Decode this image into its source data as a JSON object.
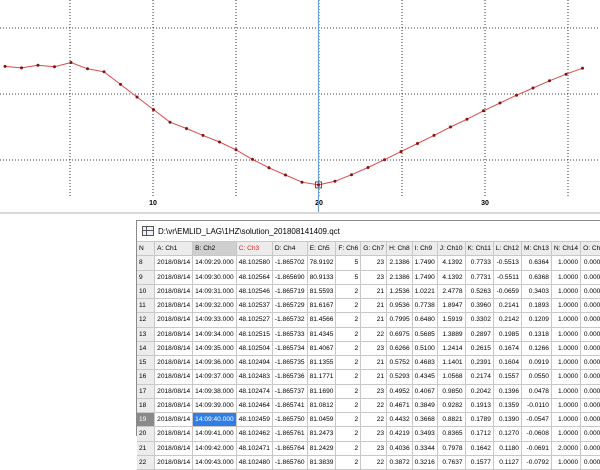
{
  "chart_data": {
    "type": "line",
    "series": [
      {
        "x": [
          0,
          1,
          2,
          3,
          4,
          5,
          6,
          7,
          8,
          9,
          10,
          11,
          12,
          13,
          14,
          15,
          16,
          17,
          18,
          19,
          20,
          21,
          22,
          23,
          24,
          25,
          26,
          27,
          28,
          29,
          30,
          31,
          32,
          33,
          34,
          35
        ],
        "y": [
          4.6,
          4.35,
          4.8,
          4.55,
          5.25,
          4.2,
          3.7,
          1.6,
          -0.5,
          -2.6,
          -4.7,
          -5.75,
          -6.9,
          -8.0,
          -9.3,
          -10.9,
          -12.3,
          -13.5,
          -14.7,
          -15.15,
          -14.55,
          -13.45,
          -12.25,
          -10.95,
          -9.6,
          -8.25,
          -6.9,
          -5.5,
          -4.2,
          -2.8,
          -1.5,
          -0.2,
          1.0,
          2.2,
          3.3,
          4.3
        ]
      }
    ],
    "x_tick_labels": [
      "10",
      "20",
      "30"
    ],
    "cursor_x": 19,
    "marker_index": 19,
    "colors": {
      "line": "#d94a4a",
      "marker": "#8b1010",
      "cursor": "#6fa2d4",
      "grid": "#000000"
    }
  },
  "window": {
    "title": "D:\\vr\\EMLID_LAG\\1HZ\\solution_201808141409.qct"
  },
  "table": {
    "headers": [
      "N",
      "A: Ch1",
      "B: Ch2",
      "C: Ch3",
      "D: Ch4",
      "E: Ch5",
      "F: Ch6",
      "G: Ch7",
      "H: Ch8",
      "I: Ch9",
      "J: Ch10",
      "K: Ch11",
      "L: Ch12",
      "M: Ch13",
      "N: Ch14",
      "O: Ch1"
    ],
    "rows": [
      [
        "8",
        "2018/08/14",
        "14:09:29.000",
        "48.102580",
        "-1.865702",
        "78.9192",
        "5",
        "23",
        "2.1386",
        "1.7490",
        "4.1392",
        "0.7733",
        "-0.5513",
        "0.6364",
        "1.0000",
        "0.0000"
      ],
      [
        "9",
        "2018/08/14",
        "14:09:30.000",
        "48.102564",
        "-1.865690",
        "80.9133",
        "5",
        "23",
        "2.1386",
        "1.7490",
        "4.1392",
        "0.7731",
        "-0.5511",
        "0.6368",
        "1.0000",
        "0.0000"
      ],
      [
        "10",
        "2018/08/14",
        "14:09:31.000",
        "48.102546",
        "-1.865719",
        "81.5593",
        "2",
        "21",
        "1.2536",
        "1.0221",
        "2.4778",
        "0.5263",
        "-0.0659",
        "0.3403",
        "1.0000",
        "0.0000"
      ],
      [
        "11",
        "2018/08/14",
        "14:09:32.000",
        "48.102537",
        "-1.865729",
        "81.6167",
        "2",
        "21",
        "0.9536",
        "0.7738",
        "1.8947",
        "0.3960",
        "0.2141",
        "0.1893",
        "1.0000",
        "0.0000"
      ],
      [
        "12",
        "2018/08/14",
        "14:09:33.000",
        "48.102527",
        "-1.865732",
        "81.4566",
        "2",
        "21",
        "0.7995",
        "0.6480",
        "1.5919",
        "0.3302",
        "0.2142",
        "0.1209",
        "1.0000",
        "0.0000"
      ],
      [
        "13",
        "2018/08/14",
        "14:09:34.000",
        "48.102515",
        "-1.865733",
        "81.4345",
        "2",
        "22",
        "0.6975",
        "0.5685",
        "1.3889",
        "0.2897",
        "0.1985",
        "0.1318",
        "1.0000",
        "0.0000"
      ],
      [
        "14",
        "2018/08/14",
        "14:09:35.000",
        "48.102504",
        "-1.865734",
        "81.4067",
        "2",
        "23",
        "0.6266",
        "0.5100",
        "1.2414",
        "0.2615",
        "0.1674",
        "0.1266",
        "1.0000",
        "0.0000"
      ],
      [
        "15",
        "2018/08/14",
        "14:09:36.000",
        "48.102494",
        "-1.865735",
        "81.1355",
        "2",
        "21",
        "0.5752",
        "0.4683",
        "1.1401",
        "0.2391",
        "0.1604",
        "0.0919",
        "1.0000",
        "0.0000"
      ],
      [
        "16",
        "2018/08/14",
        "14:09:37.000",
        "48.102483",
        "-1.865736",
        "81.1771",
        "2",
        "21",
        "0.5293",
        "0.4345",
        "1.0568",
        "0.2174",
        "0.1557",
        "0.0550",
        "1.0000",
        "0.0000"
      ],
      [
        "17",
        "2018/08/14",
        "14:09:38.000",
        "48.102474",
        "-1.865737",
        "81.1690",
        "2",
        "23",
        "0.4952",
        "0.4067",
        "0.9850",
        "0.2042",
        "0.1396",
        "0.0478",
        "1.0000",
        "0.0000"
      ],
      [
        "18",
        "2018/08/14",
        "14:09:39.000",
        "48.102464",
        "-1.865741",
        "81.0812",
        "2",
        "22",
        "0.4671",
        "0.3849",
        "0.9282",
        "0.1913",
        "0.1359",
        "-0.0110",
        "1.0000",
        "0.0000"
      ],
      [
        "19",
        "2018/08/14",
        "14:09:40.000",
        "48.102459",
        "-1.865750",
        "81.0459",
        "2",
        "22",
        "0.4432",
        "0.3668",
        "0.8821",
        "0.1789",
        "0.1390",
        "-0.0547",
        "1.0000",
        "0.0000"
      ],
      [
        "20",
        "2018/08/14",
        "14:09:41.000",
        "48.102462",
        "-1.865761",
        "81.2473",
        "2",
        "23",
        "0.4219",
        "0.3493",
        "0.8365",
        "0.1712",
        "0.1270",
        "-0.0608",
        "1.0000",
        "0.0000"
      ],
      [
        "21",
        "2018/08/14",
        "14:09:42.000",
        "48.102471",
        "-1.865764",
        "81.2429",
        "2",
        "23",
        "0.4036",
        "0.3344",
        "0.7978",
        "0.1642",
        "0.1180",
        "-0.0691",
        "2.0000",
        "0.0000"
      ],
      [
        "22",
        "2018/08/14",
        "14:09:43.000",
        "48.102480",
        "-1.865760",
        "81.3839",
        "2",
        "22",
        "0.3872",
        "0.3216",
        "0.7637",
        "0.1577",
        "0.1127",
        "-0.0792",
        "1.0000",
        "0.0000"
      ]
    ],
    "selected_row": "19"
  }
}
